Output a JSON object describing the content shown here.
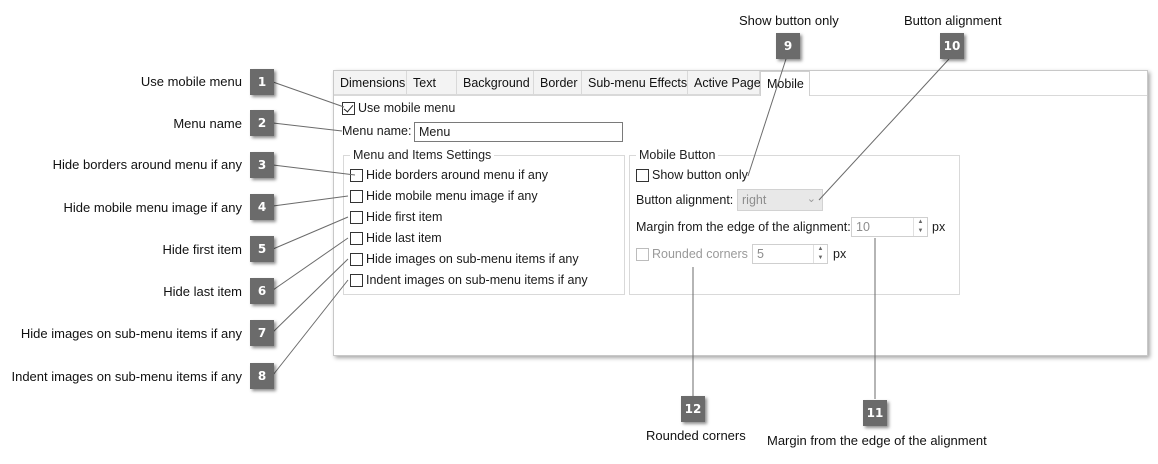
{
  "callouts": {
    "c1": {
      "num": "1",
      "label": "Use mobile menu"
    },
    "c2": {
      "num": "2",
      "label": "Menu name"
    },
    "c3": {
      "num": "3",
      "label": "Hide borders around menu if any"
    },
    "c4": {
      "num": "4",
      "label": "Hide mobile menu image if any"
    },
    "c5": {
      "num": "5",
      "label": "Hide first item"
    },
    "c6": {
      "num": "6",
      "label": "Hide last item"
    },
    "c7": {
      "num": "7",
      "label": "Hide images on sub-menu items if any"
    },
    "c8": {
      "num": "8",
      "label": "Indent images on sub-menu items if any"
    },
    "c9": {
      "num": "9",
      "label": "Show button only"
    },
    "c10": {
      "num": "10",
      "label": "Button alignment"
    },
    "c11": {
      "num": "11",
      "label": "Margin from the edge of the alignment"
    },
    "c12": {
      "num": "12",
      "label": "Rounded corners"
    }
  },
  "tabs": [
    "Dimensions",
    "Text",
    "Background",
    "Border",
    "Sub-menu Effects",
    "Active Page",
    "Mobile"
  ],
  "active_tab": "Mobile",
  "form": {
    "use_mobile_menu": {
      "label": "Use mobile menu",
      "checked": true
    },
    "menu_name": {
      "label": "Menu name:",
      "value": "Menu"
    },
    "menu_items_settings": {
      "legend": "Menu and Items Settings",
      "options": [
        {
          "label": "Hide borders around menu if any",
          "checked": false
        },
        {
          "label": "Hide mobile menu image if any",
          "checked": false
        },
        {
          "label": "Hide first item",
          "checked": false
        },
        {
          "label": "Hide last item",
          "checked": false
        },
        {
          "label": "Hide images on sub-menu items if any",
          "checked": false
        },
        {
          "label": "Indent images on sub-menu items if any",
          "checked": false
        }
      ]
    },
    "mobile_button": {
      "legend": "Mobile Button",
      "show_button_only": {
        "label": "Show button only",
        "checked": false
      },
      "button_alignment": {
        "label": "Button alignment:",
        "value": "right"
      },
      "margin": {
        "label": "Margin from the edge of the alignment:",
        "value": "10",
        "unit": "px"
      },
      "rounded_corners": {
        "label": "Rounded corners",
        "value": "5",
        "unit": "px",
        "checked": false
      }
    }
  },
  "colors": {
    "callout_bg": "#6b6b6b",
    "disabled": "#9a9a9a",
    "dialog_border": "#c8c8c8"
  }
}
